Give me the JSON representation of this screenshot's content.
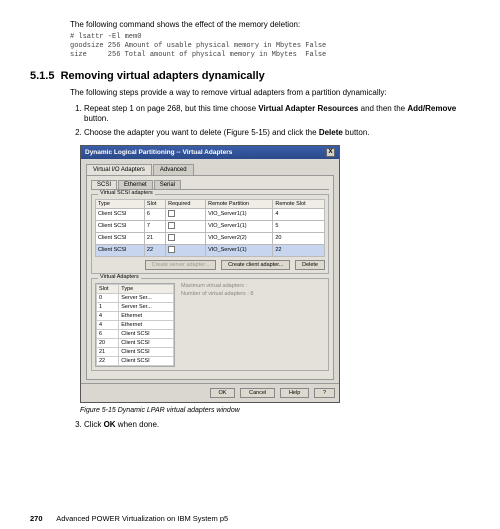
{
  "intro_text": "The following command shows the effect of the memory deletion:",
  "code_lines": [
    "# lsattr -El mem0",
    "goodsize 256 Amount of usable physical memory in Mbytes False",
    "size     256 Total amount of physical memory in Mbytes  False"
  ],
  "section_number": "5.1.5",
  "section_title": "Removing virtual adapters dynamically",
  "para_intro": "The following steps provide a way to remove virtual adapters from a partition dynamically:",
  "step1_a": "Repeat step 1 on page 268, but this time choose ",
  "step1_bold1": "Virtual Adapter Resources",
  "step1_b": " and then the ",
  "step1_bold2": "Add/Remove",
  "step1_c": " button.",
  "step2_a": "Choose the adapter you want to delete (Figure 5-15) and click the ",
  "step2_bold": "Delete",
  "step2_b": " button.",
  "step3_a": "Click ",
  "step3_bold": "OK",
  "step3_b": " when done.",
  "dialog": {
    "title": "Dynamic Logical Partitioning -- Virtual Adapters",
    "close": "X",
    "tab_virtual": "Virtual I/O Adapters",
    "tab_advanced": "Advanced",
    "subtab_scsi": "SCSI",
    "subtab_ethernet": "Ethernet",
    "subtab_serial": "Serial",
    "group1_title": "Virtual SCSI adapters",
    "headers": {
      "type": "Type",
      "slot": "Slot",
      "required": "Required",
      "remote_partition": "Remote Partition",
      "remote_slot": "Remote Slot"
    },
    "rows": [
      {
        "type": "Client SCSI",
        "slot": "6",
        "rp": "VIO_Server1(1)",
        "rs": "4"
      },
      {
        "type": "Client SCSI",
        "slot": "7",
        "rp": "VIO_Server1(1)",
        "rs": "5"
      },
      {
        "type": "Client SCSI",
        "slot": "21",
        "rp": "VIO_Server2(2)",
        "rs": "20"
      },
      {
        "type": "Client SCSI",
        "slot": "22",
        "rp": "VIO_Server1(1)",
        "rs": "22"
      }
    ],
    "btn_create_server": "Create server adapter...",
    "btn_create_client": "Create client adapter...",
    "btn_delete": "Delete",
    "group2_title": "Virtual Adapters",
    "va_headers": {
      "slot": "Slot",
      "type": "Type"
    },
    "va_rows": [
      {
        "slot": "0",
        "type": "Server Ser..."
      },
      {
        "slot": "1",
        "type": "Server Ser..."
      },
      {
        "slot": "4",
        "type": "Ethernet"
      },
      {
        "slot": "4",
        "type": "Ethernet"
      },
      {
        "slot": "6",
        "type": "Client SCSI"
      },
      {
        "slot": "20",
        "type": "Client SCSI"
      },
      {
        "slot": "21",
        "type": "Client SCSI"
      },
      {
        "slot": "22",
        "type": "Client SCSI"
      }
    ],
    "max_label": "Maximum virtual adapters :",
    "num_label": "Number of virtual adapters : 8",
    "btn_ok": "OK",
    "btn_cancel": "Cancel",
    "btn_help": "Help",
    "help_q": "?"
  },
  "figcaption": "Figure 5-15   Dynamic LPAR virtual adapters window",
  "footer": {
    "page": "270",
    "book": "Advanced POWER Virtualization on IBM System p5"
  }
}
